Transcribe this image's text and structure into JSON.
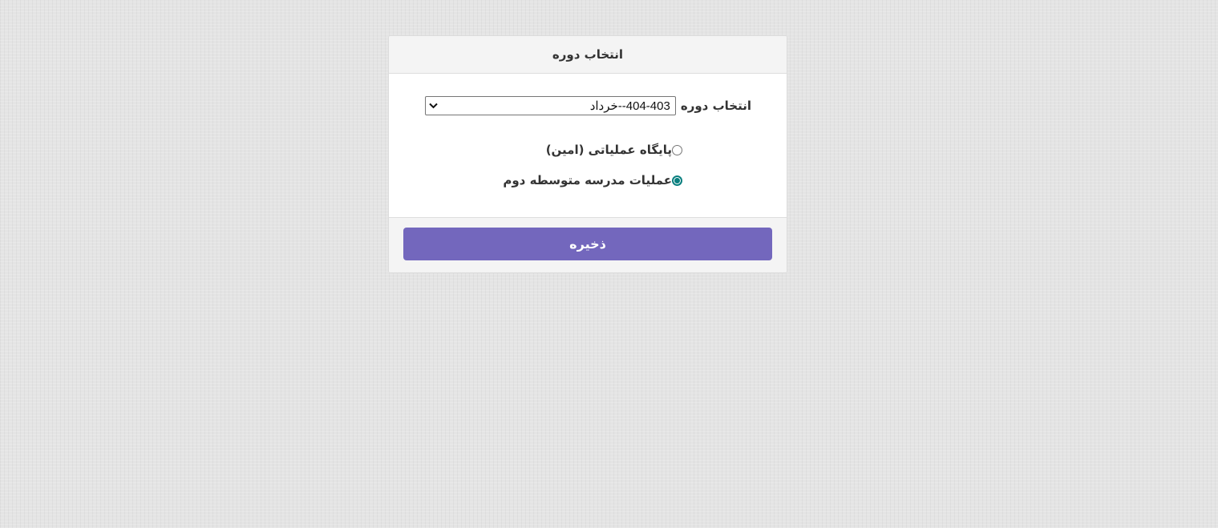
{
  "card": {
    "title": "انتخاب دوره"
  },
  "period_select": {
    "label": "انتخاب دوره",
    "selected_value": "404-403--خرداد",
    "chevron_icon": "chevron-down-icon"
  },
  "options": [
    {
      "label": "پایگاه عملیاتی (امین)",
      "checked": false
    },
    {
      "label": "عملیات مدرسه متوسطه دوم",
      "checked": true
    }
  ],
  "footer": {
    "save_label": "ذخیره"
  },
  "colors": {
    "accent": "#7367bd",
    "radio_checked": "#0a7f7f",
    "background": "#e4e4e4"
  }
}
